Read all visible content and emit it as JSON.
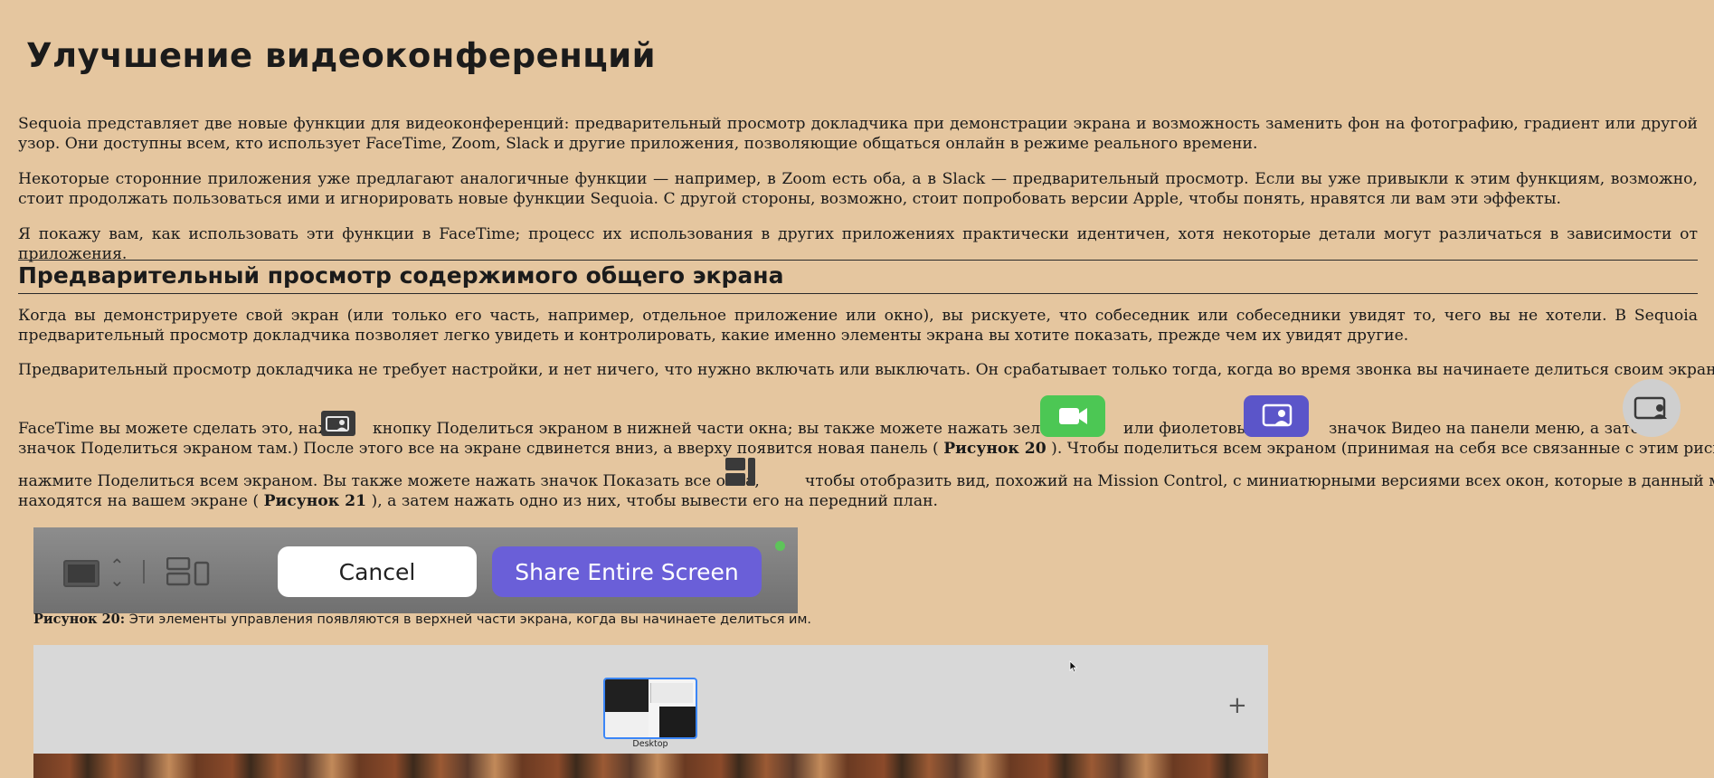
{
  "article": {
    "title": "Улучшение видеоконференций",
    "p1": "Sequoia представляет две новые функции для видеоконференций: предварительный просмотр докладчика при демонстрации экрана и возможность заменить фон на фотографию, градиент или другой узор. Они доступны всем, кто использует FaceTime, Zoom, Slack и другие приложения, позволяющие общаться онлайн в режиме реального времени.",
    "p2": "Некоторые сторонние приложения уже предлагают аналогичные функции — например, в Zoom есть оба, а в Slack — предварительный просмотр. Если вы уже привыкли к этим функциям, возможно, стоит продолжать пользоваться ими и игнорировать новые функции Sequoia. С другой стороны, возможно, стоит попробовать версии Apple, чтобы понять, нравятся ли вам эти эффекты.",
    "p3": "Я покажу вам, как использовать эти функции в FaceTime; процесс их использования в других приложениях практически идентичен, хотя некоторые детали могут различаться в зависимости от приложения.",
    "h2": "Предварительный просмотр содержимого общего экрана",
    "p4": "Когда вы демонстрируете свой экран (или только его часть, например, отдельное приложение или окно), вы рискуете, что собеседник или собеседники увидят то, чего вы не хотели. В Sequoia предварительный просмотр докладчика позволяет легко увидеть и контролировать, какие именно элементы экрана вы хотите показать, прежде чем их увидят другие.",
    "p5_line1": "Предварительный просмотр докладчика не требует настройки, и нет ничего, что нужно включать или выключать. Он срабатывает только тогда, когда во время звонка вы начинаете делиться своим экраном. (В",
    "p5_seg1": "FaceTime вы можете сделать это, нажав",
    "p5_seg2": "кнопку Поделиться экраном в нижней части окна; вы также можете нажать зеленый",
    "p5_seg3": "или фиолетовый",
    "p5_seg4": "значок Видео на панели меню, а затем",
    "p5_line3a": "значок Поделиться экраном там.) После этого все на экране сдвинется вниз, а вверху появится новая панель (",
    "p5_ref20": "Рисунок 20",
    "p5_line3b": "). Чтобы поделиться всем экраном (принимая на себя все связанные с этим риски),",
    "p5_line4a": "нажмите Поделиться всем экраном. Вы также можете нажать значок Показать все окна,",
    "p5_line4b": "чтобы отобразить вид, похожий на Mission Control, с миниатюрными версиями всех окон, которые в данный момент",
    "p5_line5a": "находятся на вашем экране (",
    "p5_ref21": "Рисунок 21",
    "p5_line5b": "), а затем нажать одно из них, чтобы вывести его на передний план."
  },
  "icons": {
    "share_screen": "share-screen-icon",
    "video_green": "video-camera-icon",
    "video_purple": "share-screen-icon",
    "share_round": "share-screen-icon",
    "show_all_windows": "show-all-windows-icon",
    "green": "#4cc754",
    "purple": "#5b55c9"
  },
  "figure20": {
    "cancel_label": "Cancel",
    "share_label": "Share Entire Screen",
    "caption_label": "Рисунок 20:",
    "caption_text": "Эти элементы управления появляются в верхней части экрана, когда вы начинаете делиться им.",
    "share_color": "#6a5fd8"
  },
  "figure21": {
    "thumb_label": "Desktop",
    "thumb_border": "#3b86f7"
  }
}
